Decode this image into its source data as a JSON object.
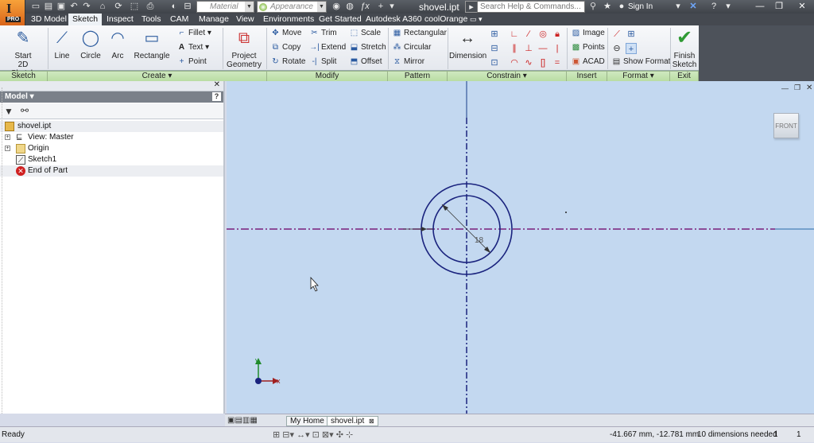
{
  "app": {
    "badge": "PRO",
    "doc_title": "shovel.ipt"
  },
  "qat": {
    "material": "Material",
    "appearance": "Appearance"
  },
  "search": {
    "placeholder": "Search Help & Commands..."
  },
  "account": {
    "sign_in": "Sign In"
  },
  "tabs": [
    {
      "label": "3D Model"
    },
    {
      "label": "Sketch"
    },
    {
      "label": "Inspect"
    },
    {
      "label": "Tools"
    },
    {
      "label": "CAM"
    },
    {
      "label": "Manage"
    },
    {
      "label": "View"
    },
    {
      "label": "Environments"
    },
    {
      "label": "Get Started"
    },
    {
      "label": "Autodesk A360"
    },
    {
      "label": "coolOrange"
    }
  ],
  "ribbon": {
    "start_sketch": "Start",
    "start_sketch2": "2D Sketch",
    "line": "Line",
    "circle": "Circle",
    "arc": "Arc",
    "rectangle": "Rectangle",
    "fillet": "Fillet",
    "text": "Text",
    "point": "Point",
    "project_geometry": "Project",
    "project_geometry2": "Geometry",
    "move": "Move",
    "copy": "Copy",
    "rotate": "Rotate",
    "trim": "Trim",
    "extend": "Extend",
    "split": "Split",
    "scale": "Scale",
    "stretch": "Stretch",
    "offset": "Offset",
    "pat_rect": "Rectangular",
    "pat_circ": "Circular",
    "mirror": "Mirror",
    "dimension": "Dimension",
    "image": "Image",
    "points": "Points",
    "acad": "ACAD",
    "show_format": "Show Format",
    "finish": "Finish",
    "finish2": "Sketch"
  },
  "panels": {
    "sketch": "Sketch",
    "create": "Create",
    "modify": "Modify",
    "pattern": "Pattern",
    "constrain": "Constrain",
    "insert": "Insert",
    "format": "Format",
    "exit": "Exit"
  },
  "browser": {
    "header": "Model",
    "items": [
      {
        "label": "shovel.ipt"
      },
      {
        "label": "View: Master"
      },
      {
        "label": "Origin"
      },
      {
        "label": "Sketch1"
      },
      {
        "label": "End of Part"
      }
    ]
  },
  "canvas": {
    "viewcube": "FRONT",
    "dim_radius": "18",
    "axis_x": "x",
    "axis_y": "y"
  },
  "doc_tabs": {
    "home": "My Home",
    "file": "shovel.ipt"
  },
  "status": {
    "ready": "Ready",
    "coords": "-41.667 mm, -12.781 mm",
    "dims_needed": "10 dimensions needed",
    "count1": "1",
    "count2": "1"
  },
  "colors": {
    "canvas_bg": "#c3d8f0",
    "sketch_geometry": "#1a237e",
    "centerline": "#7a1f7a",
    "accent": "#f0921e"
  }
}
